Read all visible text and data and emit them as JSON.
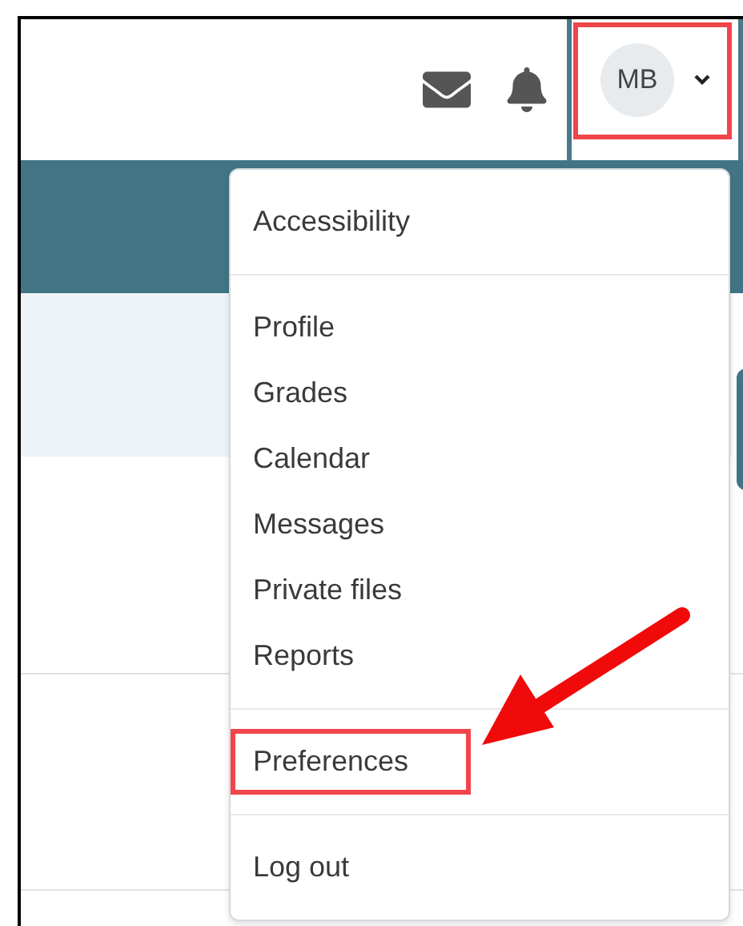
{
  "header": {
    "avatar": {
      "initials": "MB",
      "highlighted": true
    }
  },
  "menu": {
    "groups": [
      {
        "items": [
          {
            "label": "Accessibility",
            "highlighted": false
          }
        ]
      },
      {
        "items": [
          {
            "label": "Profile",
            "highlighted": false
          },
          {
            "label": "Grades",
            "highlighted": false
          },
          {
            "label": "Calendar",
            "highlighted": false
          },
          {
            "label": "Messages",
            "highlighted": false
          },
          {
            "label": "Private files",
            "highlighted": false
          },
          {
            "label": "Reports",
            "highlighted": false
          }
        ]
      },
      {
        "items": [
          {
            "label": "Preferences",
            "highlighted": true
          }
        ]
      },
      {
        "items": [
          {
            "label": "Log out",
            "highlighted": false
          }
        ]
      }
    ]
  }
}
